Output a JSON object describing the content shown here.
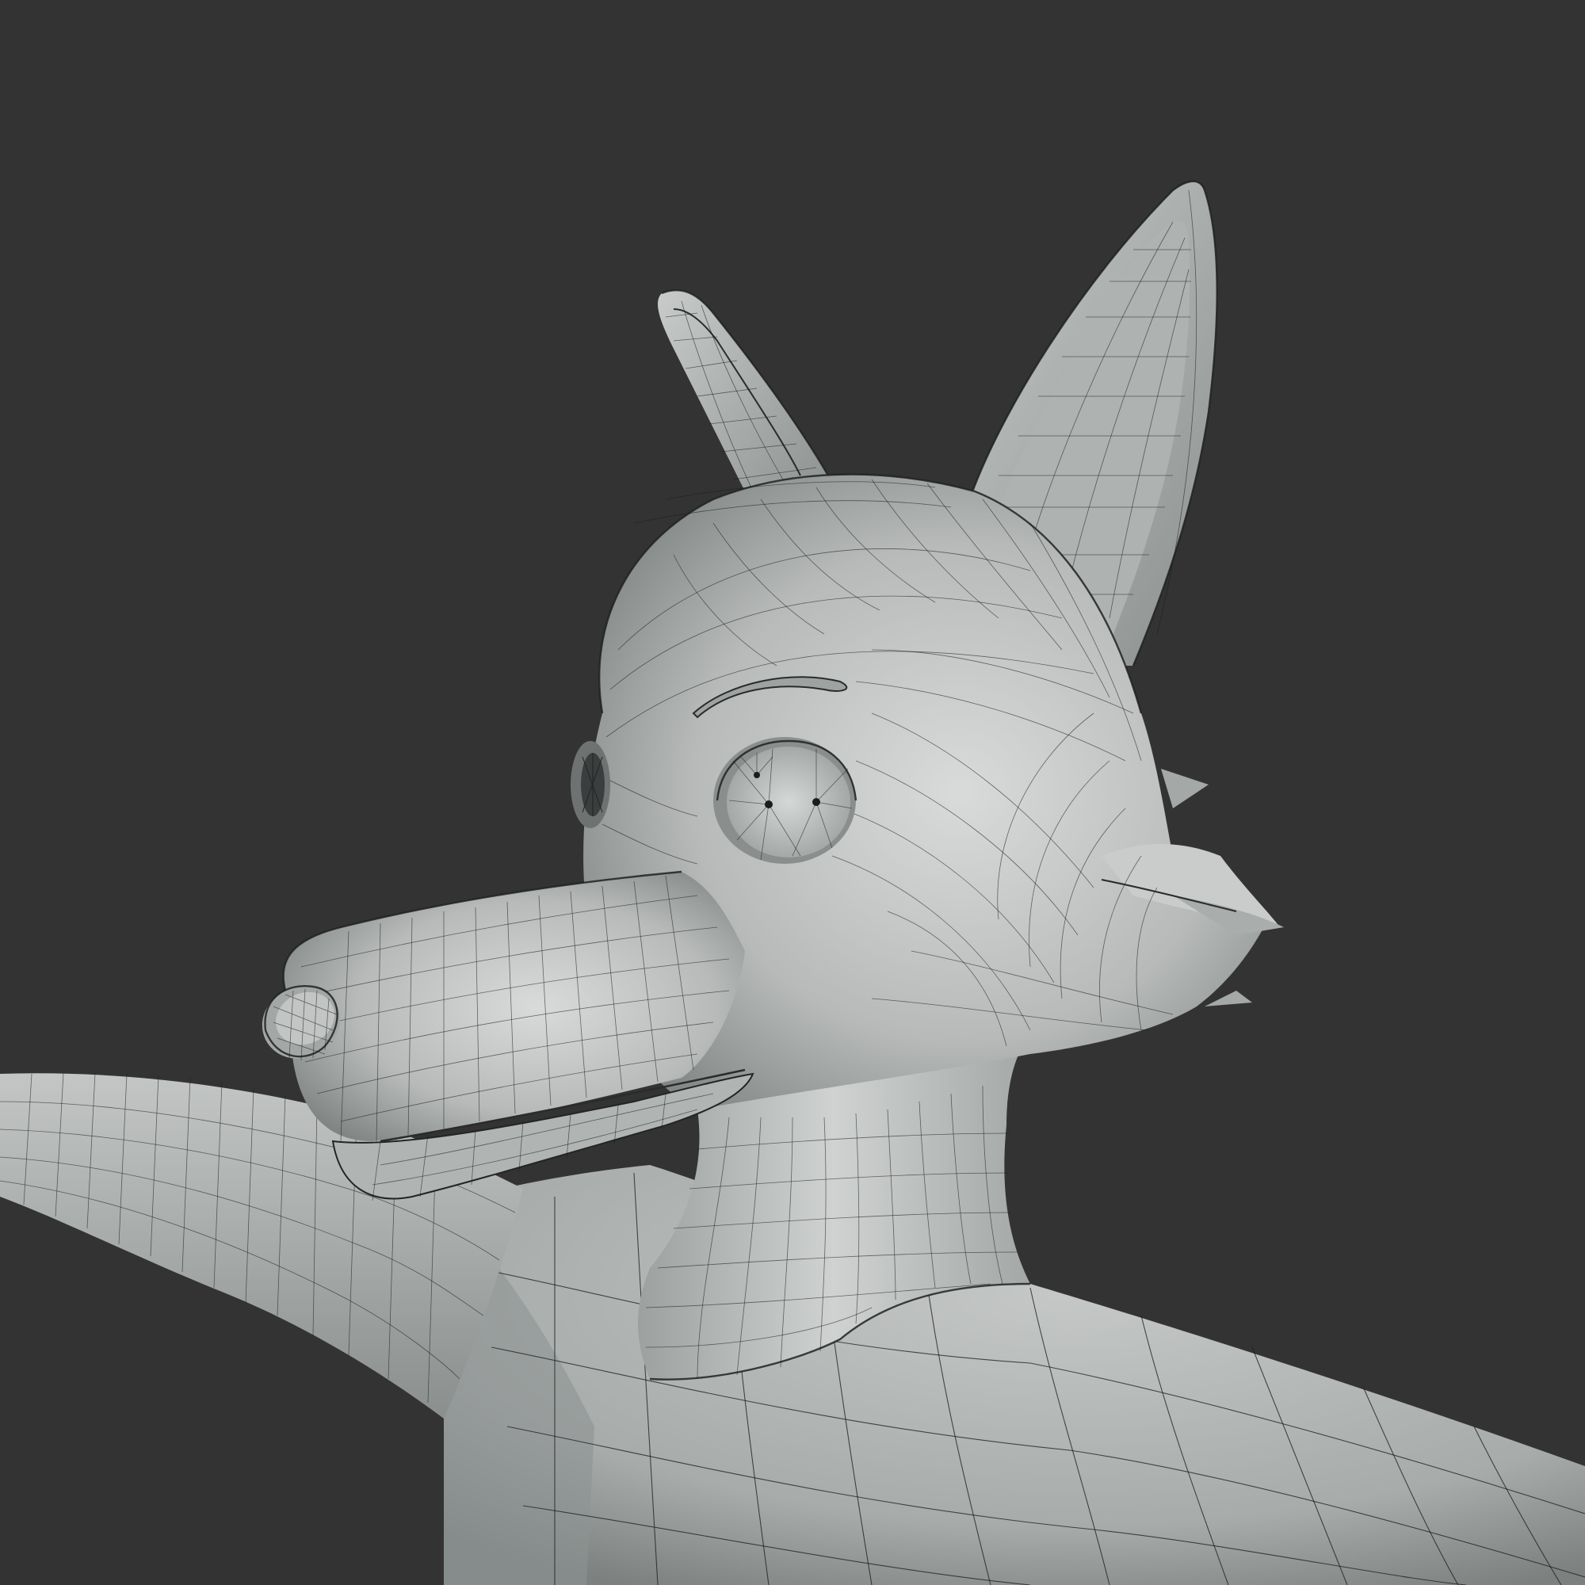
{
  "viewport": {
    "background_color": "#333333",
    "shading": "solid",
    "overlay": "wireframe"
  },
  "model": {
    "subject": "fox-character-head-and-torso",
    "surface_color": "#b9bcbb",
    "highlight_color": "#d7d9d8",
    "shadow_color": "#6f7473",
    "wire_color": "#1a1c1c"
  }
}
